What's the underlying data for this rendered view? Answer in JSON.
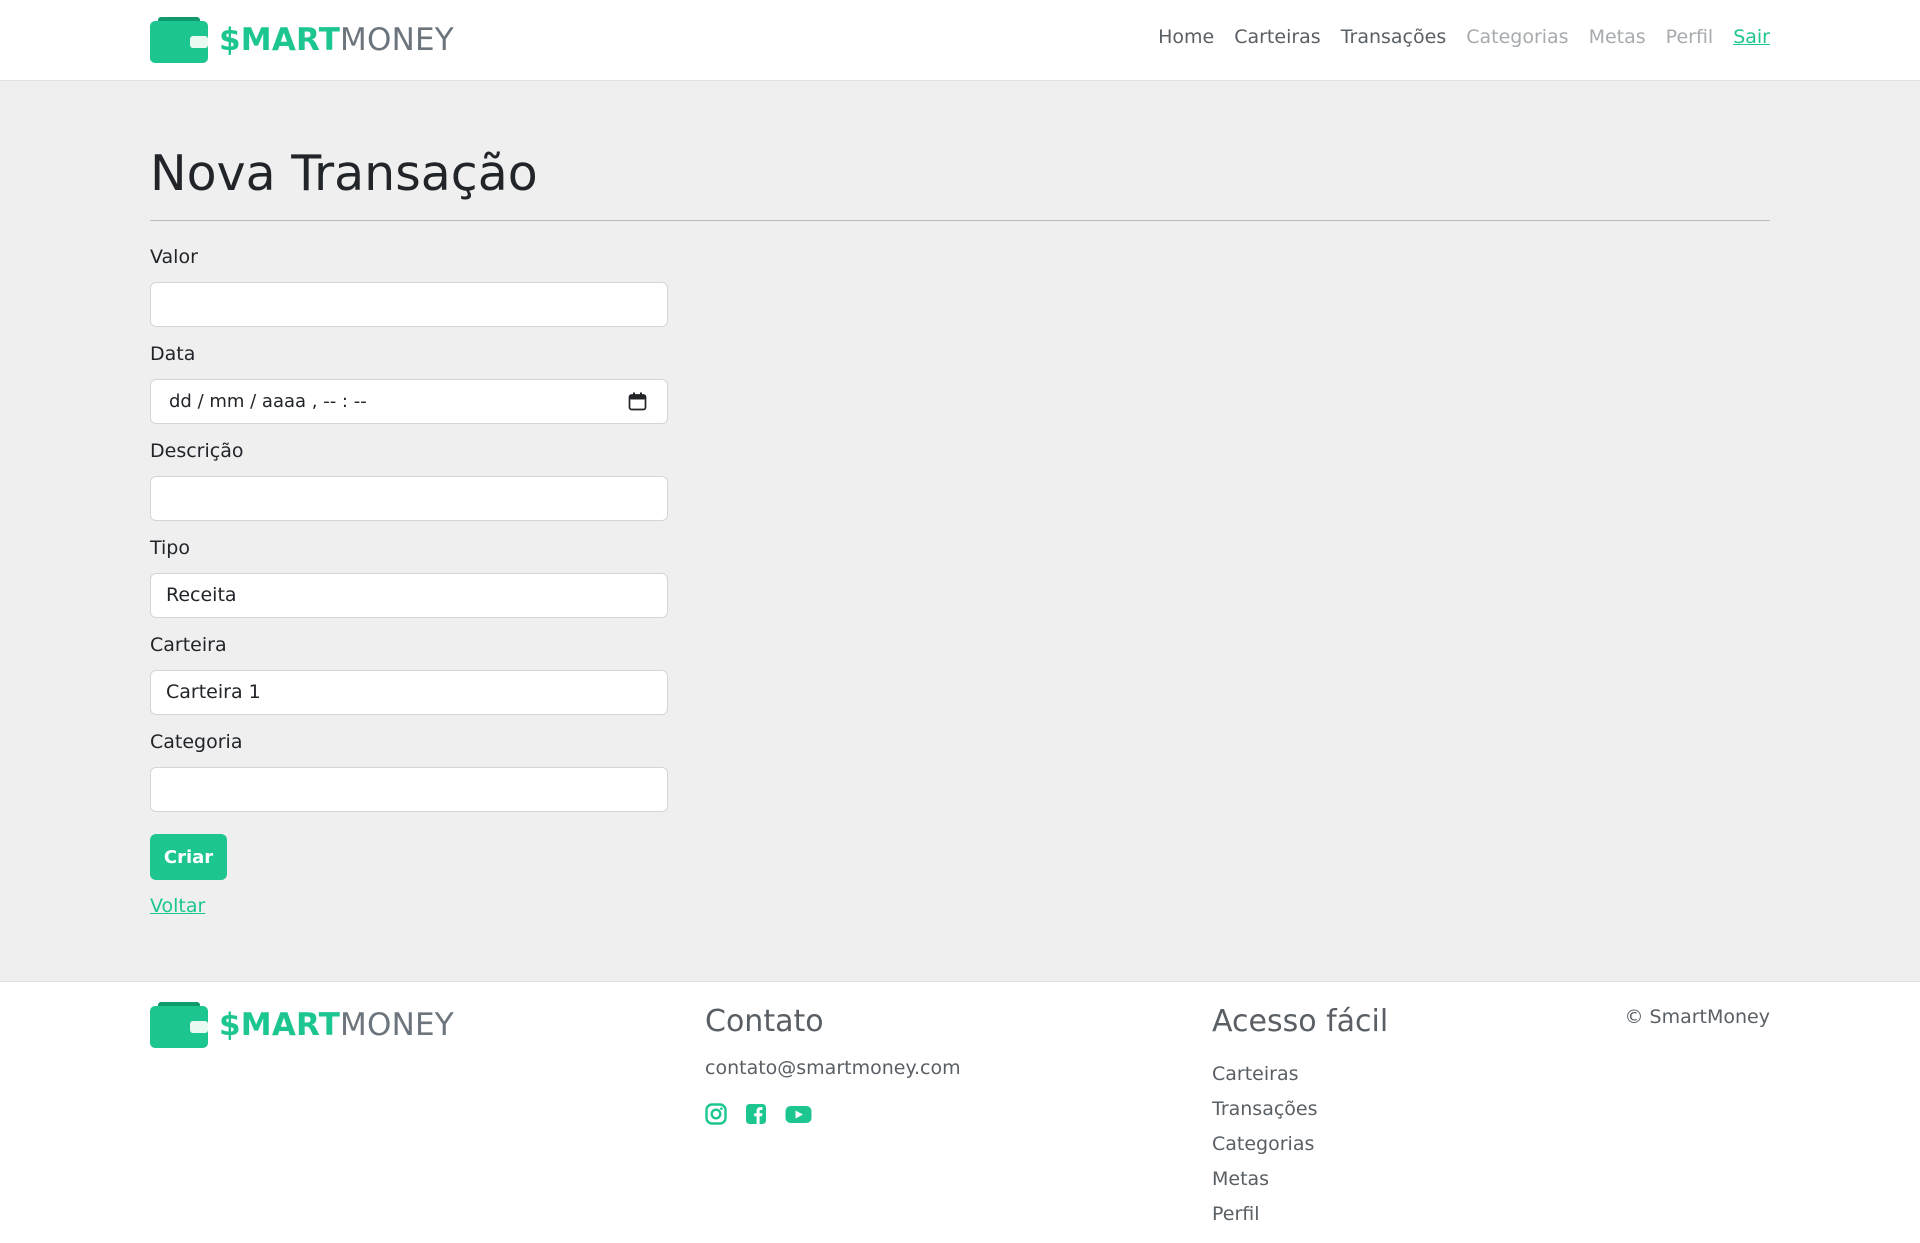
{
  "header": {
    "logo": {
      "brand": "$MART",
      "rest": "MONEY"
    },
    "nav": [
      {
        "label": "Home",
        "state": "normal"
      },
      {
        "label": "Carteiras",
        "state": "normal"
      },
      {
        "label": "Transações",
        "state": "normal"
      },
      {
        "label": "Categorias",
        "state": "muted"
      },
      {
        "label": "Metas",
        "state": "muted"
      },
      {
        "label": "Perfil",
        "state": "muted"
      },
      {
        "label": "Sair",
        "state": "accent"
      }
    ]
  },
  "form": {
    "title": "Nova Transação",
    "fields": {
      "valor": {
        "label": "Valor",
        "value": ""
      },
      "data": {
        "label": "Data",
        "value": "dd / mm / aaaa ,  -- : --"
      },
      "descricao": {
        "label": "Descrição",
        "value": ""
      },
      "tipo": {
        "label": "Tipo",
        "value": "Receita"
      },
      "carteira": {
        "label": "Carteira",
        "value": "Carteira 1"
      },
      "categoria": {
        "label": "Categoria",
        "value": ""
      }
    },
    "submit_label": "Criar",
    "back_label": "Voltar"
  },
  "footer": {
    "logo": {
      "brand": "$MART",
      "rest": "MONEY"
    },
    "contact": {
      "heading": "Contato",
      "email": "contato@smartmoney.com",
      "social_icons": [
        "instagram-icon",
        "facebook-icon",
        "youtube-icon"
      ]
    },
    "quick_access": {
      "heading": "Acesso fácil",
      "links": [
        "Carteiras",
        "Transações",
        "Categorias",
        "Metas",
        "Perfil"
      ]
    },
    "copyright": "© SmartMoney"
  },
  "colors": {
    "accent": "#1dc690",
    "accent_dark": "#0f9a6c",
    "text_muted": "#595f64",
    "page_bg": "#efefef"
  }
}
